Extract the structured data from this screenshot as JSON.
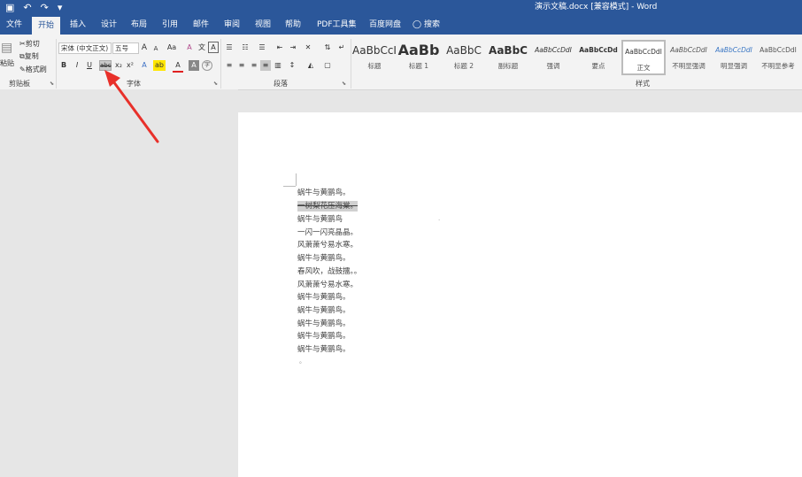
{
  "titlebar": {
    "title": "演示文稿.docx [兼容模式] - Word",
    "save_icon": "▣",
    "undo_icon": "↶",
    "redo_icon": "↷",
    "customize_icon": "▾"
  },
  "tabs": [
    "文件",
    "开始",
    "插入",
    "设计",
    "布局",
    "引用",
    "邮件",
    "审阅",
    "视图",
    "帮助",
    "PDF工具集",
    "百度网盘"
  ],
  "search": {
    "icon": "lightbulb-icon",
    "label": "搜索"
  },
  "clipboard": {
    "paste": "粘贴",
    "cut": "剪切",
    "copy": "复制",
    "format_painter": "格式刷",
    "group": "剪贴板"
  },
  "font": {
    "name": "宋体 (中文正文)",
    "size": "五号",
    "group": "字体",
    "bold": "B",
    "italic": "I",
    "underline": "U",
    "strike": "abc",
    "subscript": "x₂",
    "superscript": "x²",
    "grow": "A",
    "shrink": "A",
    "case": "Aa",
    "clear": "A",
    "phonetic": "文",
    "border": "A",
    "effects": "A",
    "highlight": "ab",
    "color": "A",
    "shade": "A",
    "enclose": "字"
  },
  "paragraph": {
    "group": "段落"
  },
  "styles": {
    "group": "样式",
    "items": [
      {
        "preview": "AaBbCcI",
        "name": "标题"
      },
      {
        "preview": "AaBb",
        "name": "标题 1"
      },
      {
        "preview": "AaBbC",
        "name": "标题 2"
      },
      {
        "preview": "AaBbC",
        "name": "副标题"
      },
      {
        "preview": "AaBbCcDdI",
        "name": "强调"
      },
      {
        "preview": "AaBbCcDd",
        "name": "要点"
      },
      {
        "preview": "AaBbCcDdI",
        "name": "正文"
      },
      {
        "preview": "AaBbCcDdI",
        "name": "不明显强调"
      },
      {
        "preview": "AaBbCcDdI",
        "name": "明显强调"
      },
      {
        "preview": "AaBbCcDdI",
        "name": "不明显参考"
      }
    ]
  },
  "document": {
    "lines": [
      "蜗牛与黄鹂鸟。",
      "一树梨花压海棠。",
      "蜗牛与黄鹂鸟",
      "一闪一闪亮晶晶。",
      "风萧萧兮易水寒。",
      "蜗牛与黄鹂鸟。",
      "春风吹，战鼓擂。。",
      "风萧萧兮易水寒。",
      "蜗牛与黄鹂鸟。",
      "蜗牛与黄鹂鸟。",
      "蜗牛与黄鹂鸟。",
      "蜗牛与黄鹂鸟。",
      "蜗牛与黄鹂鸟。"
    ],
    "end_mark": "。",
    "stray_mark": "."
  },
  "colors": {
    "accent": "#2b579a",
    "arrow": "#e8302a"
  }
}
